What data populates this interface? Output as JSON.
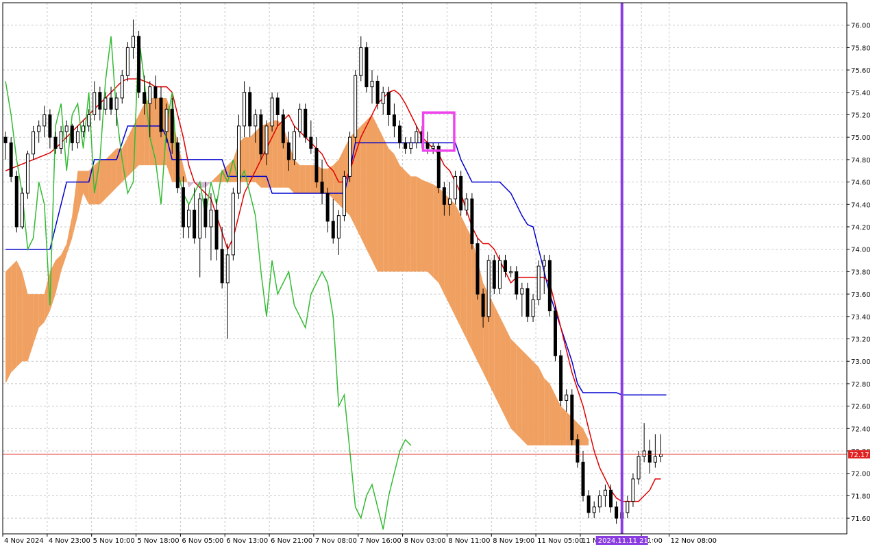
{
  "colors": {
    "background": "#ffffff",
    "grid": "#c8c8c8",
    "frame": "#000000",
    "tenkan": "#e00000",
    "kijun": "#0000d0",
    "chikou": "#33bb33",
    "senkou_bull": "#f0a060",
    "senkou_bear": "#d8bcd8",
    "candle_bull": "#ffffff",
    "candle_bear": "#000000",
    "candle_outline": "#000000",
    "price_line": "#e02020",
    "price_label_bg": "#e02020",
    "price_label_text": "#ffffff",
    "vline": "#8a3ce0",
    "vline_label_bg": "#8a3ce0",
    "highlight_box": "#ee44ee"
  },
  "price_label": "72.17",
  "cursor_time_label": "2024.11.11 21:00",
  "chart_data": {
    "type": "candlestick",
    "title": "",
    "symbol": "",
    "x_tick_labels": [
      "4 Nov 2024",
      "4 Nov 23:00",
      "5 Nov 10:00",
      "5 Nov 18:00",
      "6 Nov 05:00",
      "6 Nov 13:00",
      "6 Nov 21:00",
      "7 Nov 08:00",
      "7 Nov 16:00",
      "8 Nov 03:00",
      "8 Nov 11:00",
      "8 Nov 19:00",
      "11 Nov 05:00",
      "11 No",
      "21:00",
      "12 Nov 08:00"
    ],
    "x_tick_index": [
      0,
      8,
      16,
      24,
      32,
      40,
      48,
      56,
      64,
      72,
      80,
      88,
      96,
      104,
      115,
      120
    ],
    "y_ticks": [
      71.6,
      71.8,
      72.0,
      72.2,
      72.4,
      72.6,
      72.8,
      73.0,
      73.2,
      73.4,
      73.6,
      73.8,
      74.0,
      74.2,
      74.4,
      74.6,
      74.8,
      75.0,
      75.2,
      75.4,
      75.6,
      75.8,
      76.0
    ],
    "y_tick_labels": [
      "71.60",
      "71.80",
      "72.00",
      "72.20",
      "72.40",
      "72.60",
      "72.80",
      "73.00",
      "73.20",
      "73.40",
      "73.60",
      "73.80",
      "74.00",
      "74.20",
      "74.40",
      "74.60",
      "74.80",
      "75.00",
      "75.20",
      "75.40",
      "75.60",
      "75.80",
      "76.00"
    ],
    "ylim": [
      71.46,
      76.2
    ],
    "x_slots": 152,
    "current_price": 72.17,
    "cursor_index": 111,
    "highlight_candles": [
      76,
      80
    ],
    "highlight_price_range": [
      74.88,
      75.22
    ],
    "candles": [
      [
        75.0,
        75.05,
        74.8,
        74.95
      ],
      [
        74.95,
        75.0,
        74.6,
        74.65
      ],
      [
        74.65,
        74.7,
        74.15,
        74.2
      ],
      [
        74.2,
        74.55,
        74.18,
        74.5
      ],
      [
        74.5,
        74.88,
        74.45,
        74.85
      ],
      [
        74.85,
        75.1,
        74.8,
        75.05
      ],
      [
        75.05,
        75.15,
        74.95,
        75.1
      ],
      [
        75.1,
        75.28,
        75.0,
        75.2
      ],
      [
        75.2,
        75.25,
        74.9,
        75.0
      ],
      [
        75.0,
        75.05,
        74.85,
        74.9
      ],
      [
        74.9,
        75.1,
        74.85,
        75.05
      ],
      [
        75.05,
        75.15,
        74.95,
        75.1
      ],
      [
        75.1,
        75.12,
        74.88,
        74.95
      ],
      [
        74.95,
        75.1,
        74.9,
        75.05
      ],
      [
        75.05,
        75.15,
        75.0,
        75.1
      ],
      [
        75.1,
        75.25,
        75.05,
        75.2
      ],
      [
        75.2,
        75.5,
        75.15,
        75.4
      ],
      [
        75.4,
        75.45,
        75.15,
        75.25
      ],
      [
        75.25,
        75.4,
        75.2,
        75.35
      ],
      [
        75.35,
        75.45,
        75.2,
        75.25
      ],
      [
        75.25,
        75.4,
        75.1,
        75.35
      ],
      [
        75.35,
        75.6,
        75.3,
        75.55
      ],
      [
        75.55,
        75.85,
        75.5,
        75.8
      ],
      [
        75.8,
        76.05,
        75.7,
        75.9
      ],
      [
        75.9,
        75.95,
        75.35,
        75.4
      ],
      [
        75.4,
        75.55,
        75.2,
        75.3
      ],
      [
        75.3,
        75.5,
        75.0,
        75.45
      ],
      [
        75.45,
        75.55,
        75.25,
        75.35
      ],
      [
        75.35,
        75.45,
        75.0,
        75.05
      ],
      [
        75.05,
        75.3,
        74.95,
        75.25
      ],
      [
        75.25,
        75.35,
        74.85,
        74.95
      ],
      [
        74.95,
        75.0,
        74.5,
        74.55
      ],
      [
        74.55,
        74.65,
        74.1,
        74.2
      ],
      [
        74.2,
        74.4,
        74.1,
        74.35
      ],
      [
        74.35,
        74.55,
        74.05,
        74.1
      ],
      [
        74.1,
        74.5,
        73.75,
        74.45
      ],
      [
        74.45,
        74.6,
        74.1,
        74.2
      ],
      [
        74.2,
        74.5,
        73.9,
        74.35
      ],
      [
        74.35,
        74.45,
        73.9,
        74.0
      ],
      [
        74.0,
        74.2,
        73.65,
        73.7
      ],
      [
        73.7,
        74.05,
        73.2,
        73.95
      ],
      [
        73.95,
        74.55,
        73.9,
        74.5
      ],
      [
        74.5,
        75.2,
        74.45,
        75.1
      ],
      [
        75.1,
        75.5,
        75.0,
        75.4
      ],
      [
        75.4,
        75.45,
        75.0,
        75.1
      ],
      [
        75.1,
        75.25,
        74.95,
        75.2
      ],
      [
        75.2,
        75.25,
        74.8,
        74.85
      ],
      [
        74.85,
        75.15,
        74.75,
        75.1
      ],
      [
        75.1,
        75.4,
        75.05,
        75.35
      ],
      [
        75.35,
        75.4,
        75.1,
        75.2
      ],
      [
        75.2,
        75.25,
        74.9,
        74.95
      ],
      [
        74.95,
        75.05,
        74.7,
        74.8
      ],
      [
        74.8,
        75.1,
        74.75,
        75.05
      ],
      [
        75.05,
        75.3,
        75.0,
        75.25
      ],
      [
        75.25,
        75.3,
        74.95,
        75.0
      ],
      [
        75.0,
        75.15,
        74.85,
        74.9
      ],
      [
        74.9,
        75.0,
        74.55,
        74.6
      ],
      [
        74.6,
        74.8,
        74.4,
        74.5
      ],
      [
        74.5,
        74.55,
        74.15,
        74.25
      ],
      [
        74.25,
        74.45,
        74.05,
        74.1
      ],
      [
        74.1,
        74.35,
        73.95,
        74.3
      ],
      [
        74.3,
        74.7,
        74.25,
        74.65
      ],
      [
        74.65,
        75.05,
        74.6,
        75.0
      ],
      [
        75.0,
        75.6,
        74.95,
        75.55
      ],
      [
        75.55,
        75.9,
        75.5,
        75.8
      ],
      [
        75.8,
        75.85,
        75.4,
        75.45
      ],
      [
        75.45,
        75.6,
        75.3,
        75.5
      ],
      [
        75.5,
        75.55,
        75.25,
        75.3
      ],
      [
        75.3,
        75.45,
        75.2,
        75.4
      ],
      [
        75.4,
        75.45,
        75.1,
        75.2
      ],
      [
        75.2,
        75.3,
        75.0,
        75.1
      ],
      [
        75.1,
        75.15,
        74.9,
        74.95
      ],
      [
        74.95,
        75.0,
        74.85,
        74.9
      ],
      [
        74.9,
        75.0,
        74.85,
        74.95
      ],
      [
        74.95,
        75.1,
        74.9,
        75.05
      ],
      [
        75.05,
        75.1,
        74.9,
        74.95
      ],
      [
        74.95,
        75.05,
        74.85,
        74.9
      ],
      [
        74.9,
        74.95,
        74.85,
        74.92
      ],
      [
        74.92,
        74.95,
        74.5,
        74.55
      ],
      [
        74.55,
        74.6,
        74.3,
        74.4
      ],
      [
        74.4,
        74.6,
        74.3,
        74.45
      ],
      [
        74.45,
        74.7,
        74.4,
        74.65
      ],
      [
        74.65,
        74.7,
        74.3,
        74.35
      ],
      [
        74.35,
        74.5,
        74.3,
        74.45
      ],
      [
        74.45,
        74.5,
        74.0,
        74.05
      ],
      [
        74.05,
        74.1,
        73.55,
        73.6
      ],
      [
        73.6,
        73.65,
        73.3,
        73.4
      ],
      [
        73.4,
        73.95,
        73.35,
        73.9
      ],
      [
        73.9,
        73.95,
        73.6,
        73.65
      ],
      [
        73.65,
        73.95,
        73.6,
        73.9
      ],
      [
        73.9,
        73.95,
        73.75,
        73.8
      ],
      [
        73.8,
        73.85,
        73.75,
        73.8
      ],
      [
        73.8,
        73.85,
        73.55,
        73.6
      ],
      [
        73.6,
        73.7,
        73.4,
        73.65
      ],
      [
        73.65,
        73.7,
        73.35,
        73.4
      ],
      [
        73.4,
        73.6,
        73.35,
        73.55
      ],
      [
        73.55,
        73.9,
        73.5,
        73.85
      ],
      [
        73.85,
        73.95,
        73.6,
        73.9
      ],
      [
        73.9,
        73.95,
        73.4,
        73.45
      ],
      [
        73.45,
        73.5,
        73.0,
        73.05
      ],
      [
        73.05,
        73.1,
        72.6,
        72.65
      ],
      [
        72.65,
        72.75,
        72.55,
        72.7
      ],
      [
        72.7,
        72.75,
        72.25,
        72.3
      ],
      [
        72.3,
        72.35,
        72.05,
        72.1
      ],
      [
        72.1,
        72.2,
        71.75,
        71.8
      ],
      [
        71.8,
        71.85,
        71.6,
        71.65
      ],
      [
        71.65,
        71.75,
        71.6,
        71.7
      ],
      [
        71.7,
        71.85,
        71.65,
        71.8
      ],
      [
        71.8,
        71.9,
        71.7,
        71.85
      ],
      [
        71.85,
        71.9,
        71.65,
        71.7
      ],
      [
        71.7,
        71.75,
        71.55,
        71.6
      ],
      [
        71.6,
        71.7,
        71.5,
        71.65
      ],
      [
        71.65,
        71.8,
        71.6,
        71.75
      ],
      [
        71.75,
        72.0,
        71.7,
        71.95
      ],
      [
        71.95,
        72.2,
        71.9,
        72.15
      ],
      [
        72.15,
        72.45,
        72.1,
        72.2
      ],
      [
        72.2,
        72.3,
        72.0,
        72.1
      ],
      [
        72.1,
        72.35,
        72.05,
        72.15
      ],
      [
        72.15,
        72.35,
        72.1,
        72.17
      ]
    ],
    "tenkan": [
      74.7,
      74.72,
      74.74,
      74.76,
      74.78,
      74.8,
      74.82,
      74.84,
      74.86,
      74.9,
      74.95,
      75.0,
      75.05,
      75.1,
      75.15,
      75.2,
      75.25,
      75.3,
      75.35,
      75.4,
      75.45,
      75.5,
      75.52,
      75.52,
      75.52,
      75.5,
      75.48,
      75.45,
      75.45,
      75.45,
      75.4,
      75.2,
      75.0,
      74.75,
      74.6,
      74.55,
      74.5,
      74.45,
      74.3,
      74.15,
      74.0,
      74.1,
      74.3,
      74.5,
      74.6,
      74.7,
      74.8,
      74.9,
      75.0,
      75.1,
      75.15,
      75.2,
      75.1,
      75.05,
      75.0,
      74.95,
      74.9,
      74.85,
      74.75,
      74.7,
      74.6,
      74.6,
      74.7,
      74.85,
      75.0,
      75.1,
      75.2,
      75.3,
      75.35,
      75.4,
      75.42,
      75.38,
      75.3,
      75.2,
      75.1,
      75.0,
      74.95,
      74.9,
      74.85,
      74.75,
      74.7,
      74.6,
      74.5,
      74.35,
      74.2,
      74.1,
      74.05,
      74.05,
      74.0,
      73.9,
      73.8,
      73.7,
      73.75,
      73.75,
      73.75,
      73.75,
      73.75,
      73.75,
      73.7,
      73.5,
      73.3,
      73.1,
      72.9,
      72.75,
      72.6,
      72.4,
      72.2,
      72.05,
      71.95,
      71.85,
      71.78,
      71.75,
      71.75,
      71.75,
      71.75,
      71.8,
      71.85,
      71.95,
      71.95
    ],
    "kijun": [
      74.0,
      74.0,
      74.0,
      74.0,
      74.0,
      74.0,
      74.0,
      74.0,
      74.0,
      74.2,
      74.4,
      74.6,
      74.6,
      74.6,
      74.6,
      74.6,
      74.8,
      74.8,
      74.8,
      74.8,
      74.8,
      74.95,
      75.1,
      75.1,
      75.1,
      75.1,
      75.1,
      75.1,
      75.1,
      75.0,
      74.8,
      74.8,
      74.8,
      74.8,
      74.8,
      74.8,
      74.8,
      74.8,
      74.8,
      74.8,
      74.65,
      74.65,
      74.65,
      74.65,
      74.65,
      74.65,
      74.65,
      74.65,
      74.5,
      74.5,
      74.5,
      74.5,
      74.5,
      74.5,
      74.5,
      74.5,
      74.5,
      74.5,
      74.5,
      74.5,
      74.5,
      74.5,
      74.7,
      74.95,
      74.95,
      74.95,
      74.95,
      74.95,
      74.95,
      74.95,
      74.95,
      74.95,
      74.95,
      74.95,
      74.95,
      74.95,
      74.95,
      74.95,
      74.95,
      74.95,
      74.95,
      74.95,
      74.8,
      74.7,
      74.6,
      74.6,
      74.6,
      74.6,
      74.6,
      74.6,
      74.55,
      74.5,
      74.4,
      74.3,
      74.22,
      74.2,
      74.0,
      73.8,
      73.6,
      73.45,
      73.3,
      73.15,
      73.0,
      72.8,
      72.72,
      72.72,
      72.72,
      72.72,
      72.72,
      72.72,
      72.72,
      72.7,
      72.7,
      72.7,
      72.7,
      72.7,
      72.7,
      72.7,
      72.7,
      72.7
    ],
    "chikou": [
      75.5,
      75.2,
      74.8,
      74.5,
      74.0,
      74.1,
      74.6,
      74.4,
      73.5,
      75.1,
      75.3,
      74.7,
      75.2,
      75.3,
      74.9,
      75.4,
      74.5,
      74.8,
      75.5,
      75.9,
      75.2,
      74.8,
      74.5,
      74.6,
      75.9,
      75.5,
      75.0,
      74.8,
      74.4,
      75.1,
      75.4,
      74.7,
      74.5,
      74.4,
      74.5,
      74.6,
      74.3,
      74.6,
      74.4,
      74.7,
      74.6,
      74.8,
      74.6,
      74.7,
      74.5,
      74.3,
      73.8,
      73.4,
      73.9,
      73.6,
      73.7,
      73.8,
      73.5,
      73.4,
      73.3,
      73.6,
      73.7,
      73.8,
      73.7,
      73.4,
      72.6,
      72.7,
      72.2,
      71.7,
      71.6,
      71.8,
      71.9,
      71.7,
      71.5,
      71.8,
      72.0,
      72.2,
      72.3,
      72.25
    ],
    "cloud_span_a": [
      73.8,
      73.85,
      73.9,
      73.8,
      73.6,
      73.6,
      73.6,
      73.6,
      73.8,
      73.9,
      73.95,
      74.05,
      74.3,
      74.7,
      74.7,
      74.7,
      74.75,
      74.8,
      74.8,
      74.85,
      74.9,
      74.9,
      75.0,
      75.1,
      75.2,
      75.3,
      75.35,
      75.35,
      75.35,
      75.35,
      75.2,
      74.95,
      74.75,
      74.55,
      74.6,
      74.55,
      74.55,
      74.6,
      74.65,
      74.7,
      74.75,
      74.8,
      74.95,
      75.0,
      75.0,
      75.05,
      75.1,
      75.12,
      75.15,
      75.15,
      75.1,
      74.95,
      74.8,
      74.75,
      74.75,
      74.75,
      74.75,
      74.72,
      74.72,
      74.75,
      74.8,
      74.9,
      75.0,
      75.05,
      75.1,
      75.15,
      75.2,
      75.1,
      75.0,
      74.9,
      74.85,
      74.75,
      74.7,
      74.65,
      74.65,
      74.62,
      74.6,
      74.58,
      74.55,
      74.5,
      74.45,
      74.4,
      74.3,
      74.2,
      74.1,
      73.9,
      73.7,
      73.6,
      73.5,
      73.4,
      73.3,
      73.2,
      73.15,
      73.1,
      73.05,
      73.0,
      72.95,
      72.85,
      72.8,
      72.7,
      72.6,
      72.55,
      72.5,
      72.45,
      72.4,
      72.3
    ],
    "cloud_span_b": [
      72.8,
      72.9,
      72.95,
      73.0,
      73.0,
      73.15,
      73.3,
      73.35,
      73.45,
      73.6,
      73.8,
      73.95,
      74.1,
      74.3,
      74.5,
      74.4,
      74.4,
      74.4,
      74.45,
      74.5,
      74.55,
      74.6,
      74.65,
      74.7,
      74.75,
      74.75,
      74.75,
      74.75,
      74.75,
      74.75,
      74.6,
      74.6,
      74.6,
      74.6,
      74.6,
      74.6,
      74.6,
      74.6,
      74.6,
      74.6,
      74.6,
      74.6,
      74.6,
      74.6,
      74.6,
      74.6,
      74.55,
      74.55,
      74.55,
      74.55,
      74.55,
      74.55,
      74.5,
      74.5,
      74.5,
      74.5,
      74.5,
      74.5,
      74.5,
      74.45,
      74.4,
      74.35,
      74.3,
      74.2,
      74.1,
      74.0,
      73.9,
      73.8,
      73.8,
      73.8,
      73.8,
      73.8,
      73.8,
      73.8,
      73.8,
      73.8,
      73.8,
      73.75,
      73.7,
      73.6,
      73.5,
      73.4,
      73.3,
      73.2,
      73.1,
      73.0,
      72.9,
      72.8,
      72.7,
      72.6,
      72.5,
      72.4,
      72.35,
      72.3,
      72.25,
      72.25,
      72.25,
      72.25,
      72.25,
      72.25,
      72.25,
      72.25,
      72.25,
      72.25,
      72.25,
      72.25
    ]
  }
}
